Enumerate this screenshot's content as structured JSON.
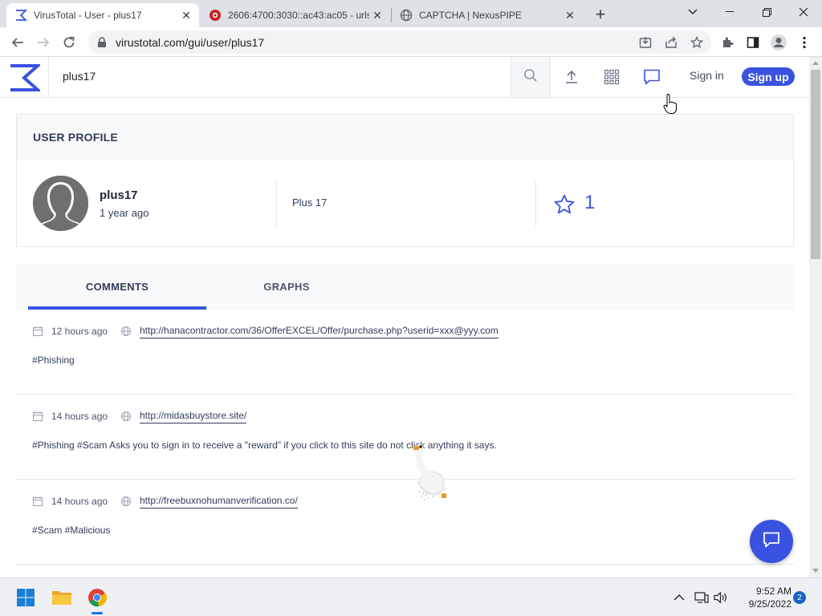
{
  "browser": {
    "tabs": [
      {
        "title": "VirusTotal - User - plus17",
        "icon": "virustotal-sigma-icon",
        "active": true
      },
      {
        "title": "2606:4700:3030::ac43:ac05 - urls",
        "icon": "urlscan-icon",
        "active": false
      },
      {
        "title": "CAPTCHA | NexusPIPE",
        "icon": "globe-icon",
        "active": false
      }
    ],
    "close_glyph": "✕",
    "new_tab_glyph": "+",
    "url": "virustotal.com/gui/user/plus17"
  },
  "vt": {
    "search_value": "plus17",
    "sign_in": "Sign in",
    "sign_up": "Sign up",
    "accent": "#3a52e0"
  },
  "profile": {
    "heading": "USER PROFILE",
    "username": "plus17",
    "member_since": "1 year ago",
    "full_name": "Plus 17",
    "reputation": "1"
  },
  "profile_tabs": [
    {
      "label": "COMMENTS",
      "active": true
    },
    {
      "label": "GRAPHS",
      "active": false
    }
  ],
  "comments": [
    {
      "date": "12 hours ago",
      "link": "http://hanacontractor.com/36/OfferEXCEL/Offer/purchase.php?userid=xxx@yyy.com",
      "text": "#Phishing"
    },
    {
      "date": "14 hours ago",
      "link": "http://midasbuystore.site/",
      "text": "#Phishing #Scam Asks you to sign in to receive a \"reward\" if you click to this site do not click anything it says."
    },
    {
      "date": "14 hours ago",
      "link": "http://freebuxnohumanverification.co/",
      "text": "#Scam #Malicious"
    }
  ],
  "taskbar": {
    "time": "9:52 AM",
    "date": "9/25/2022",
    "notifications": "2"
  }
}
